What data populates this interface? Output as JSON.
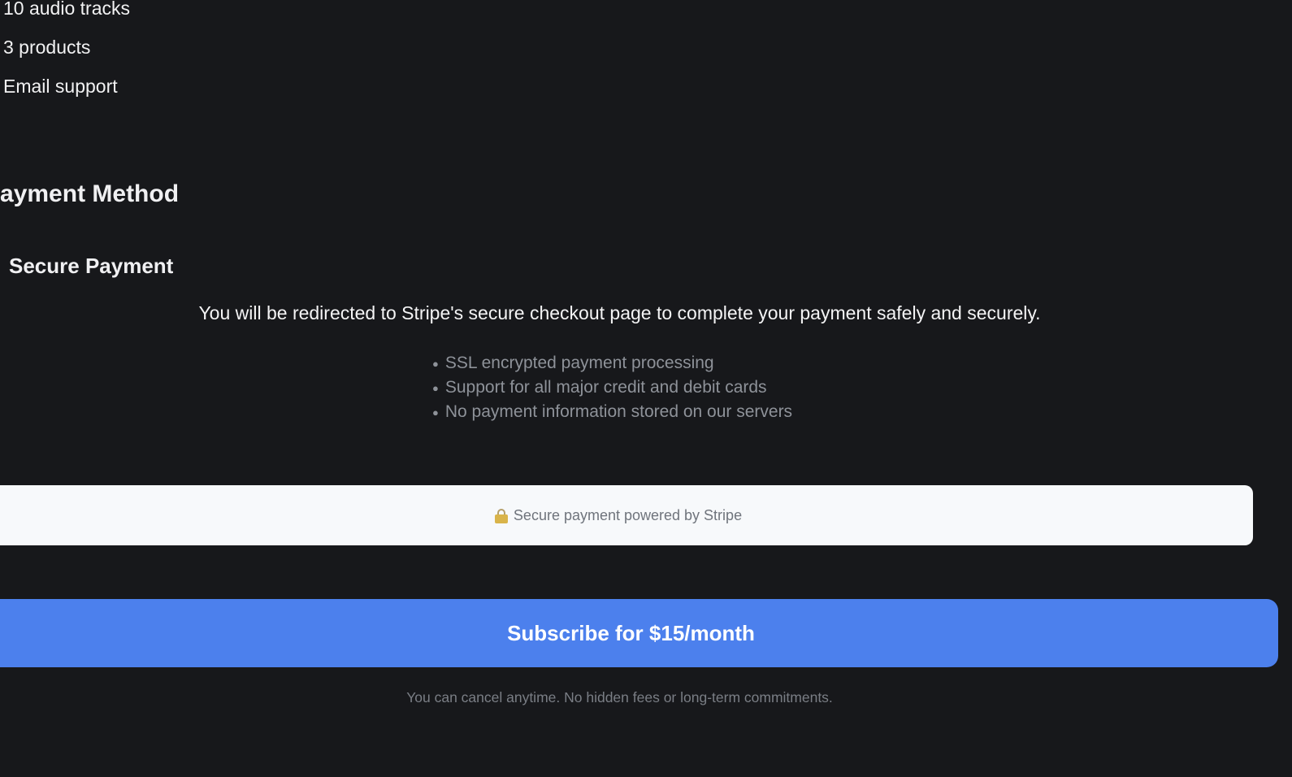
{
  "plan_features": {
    "items": [
      "10 audio tracks",
      "3 products",
      "Email support"
    ]
  },
  "payment": {
    "heading": "Payment Method",
    "secure_title": "Secure Payment",
    "redirect_text": "You will be redirected to Stripe's secure checkout page to complete your payment safely and securely.",
    "bullets": [
      "SSL encrypted payment processing",
      "Support for all major credit and debit cards",
      "No payment information stored on our servers"
    ],
    "stripe_notice": "Secure payment powered by Stripe",
    "lock_icon": "lock-icon"
  },
  "subscribe": {
    "button_label": "Subscribe for $15/month",
    "note": "You can cancel anytime. No hidden fees or long-term commitments."
  },
  "colors": {
    "background": "#17181b",
    "accent": "#4c80ed",
    "muted_text": "#8e9299",
    "notice_bg": "#f7f9fb"
  }
}
